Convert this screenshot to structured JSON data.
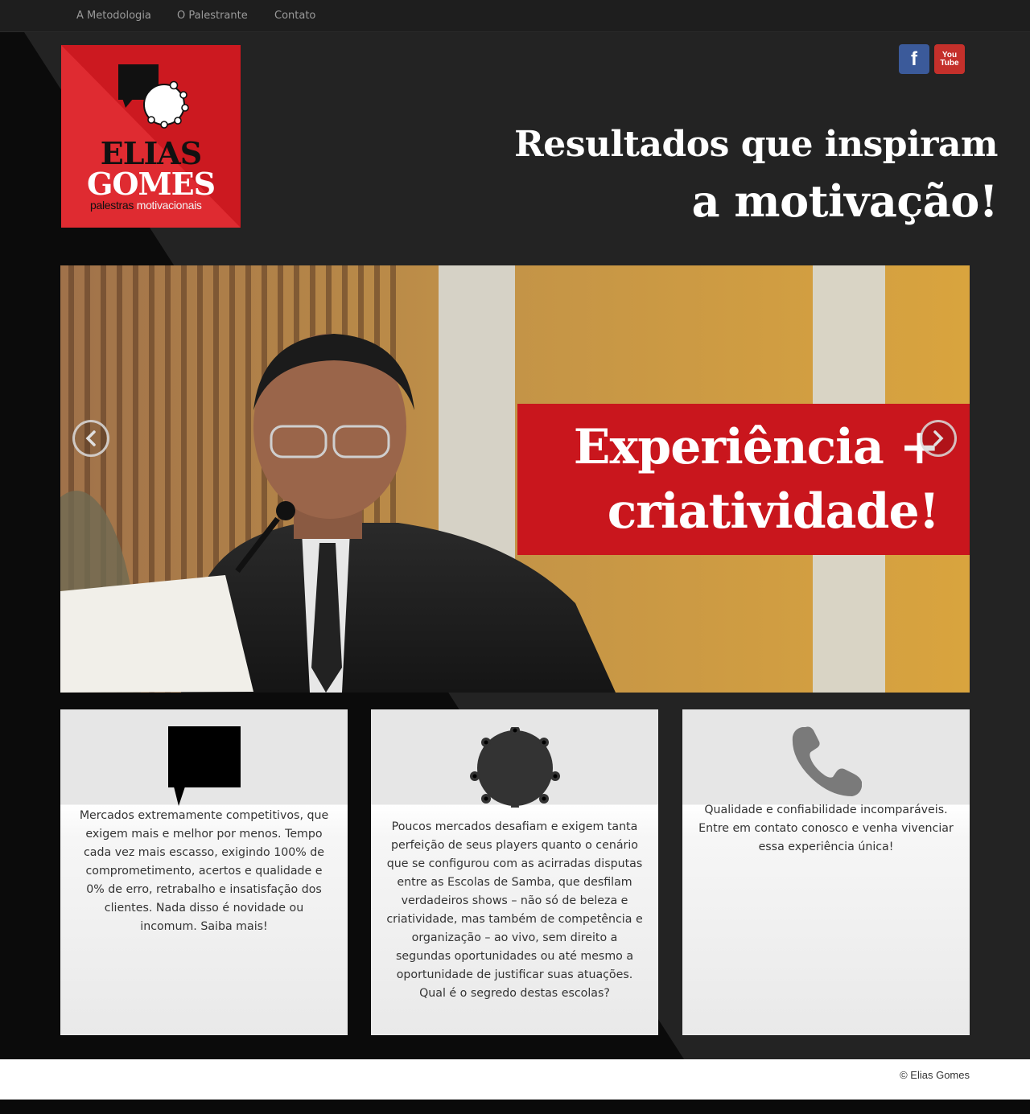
{
  "nav": {
    "items": [
      {
        "label": "A Metodologia"
      },
      {
        "label": "O Palestrante"
      },
      {
        "label": "Contato"
      }
    ]
  },
  "logo": {
    "line1": "ELIAS",
    "line2": "GOMES",
    "tag_a": "palestras",
    "tag_b": "motivacionais"
  },
  "social": {
    "facebook": "f",
    "youtube_a": "You",
    "youtube_b": "Tube"
  },
  "headline": {
    "line1": "Resultados que inspiram",
    "line2": "a motivação!"
  },
  "slider": {
    "caption_line1": "Experiência +",
    "caption_line2": "criatividade!"
  },
  "cards": [
    {
      "icon": "speech-bubble-icon",
      "text": "Mercados extremamente competitivos, que exigem mais e melhor por menos. Tempo cada vez mais escasso, exigindo 100% de comprometimento, acertos e qualidade e 0% de erro, retrabalho e insatisfação dos clientes. Nada disso é novidade ou incomum. Saiba mais!"
    },
    {
      "icon": "tambourine-icon",
      "text": "Poucos mercados desafiam e exigem tanta perfeição de seus players quanto o cenário que se configurou com as acirradas disputas entre as Escolas de Samba, que desfilam verdadeiros shows – não só de beleza e criatividade, mas também de competência e organização – ao vivo, sem direito a segundas oportunidades ou até mesmo a oportunidade de justificar suas atuações. Qual é o segredo destas escolas?"
    },
    {
      "icon": "phone-icon",
      "text": "Qualidade e confiabilidade incomparáveis. Entre em contato conosco e venha vivenciar essa experiência única!"
    }
  ],
  "footer": {
    "copyright": "© Elias Gomes"
  },
  "colors": {
    "brand_red": "#d41f26",
    "caption_red": "#c9161d",
    "page_dark": "#222222",
    "facebook_blue": "#3b5a9a",
    "youtube_red": "#c4302b"
  }
}
